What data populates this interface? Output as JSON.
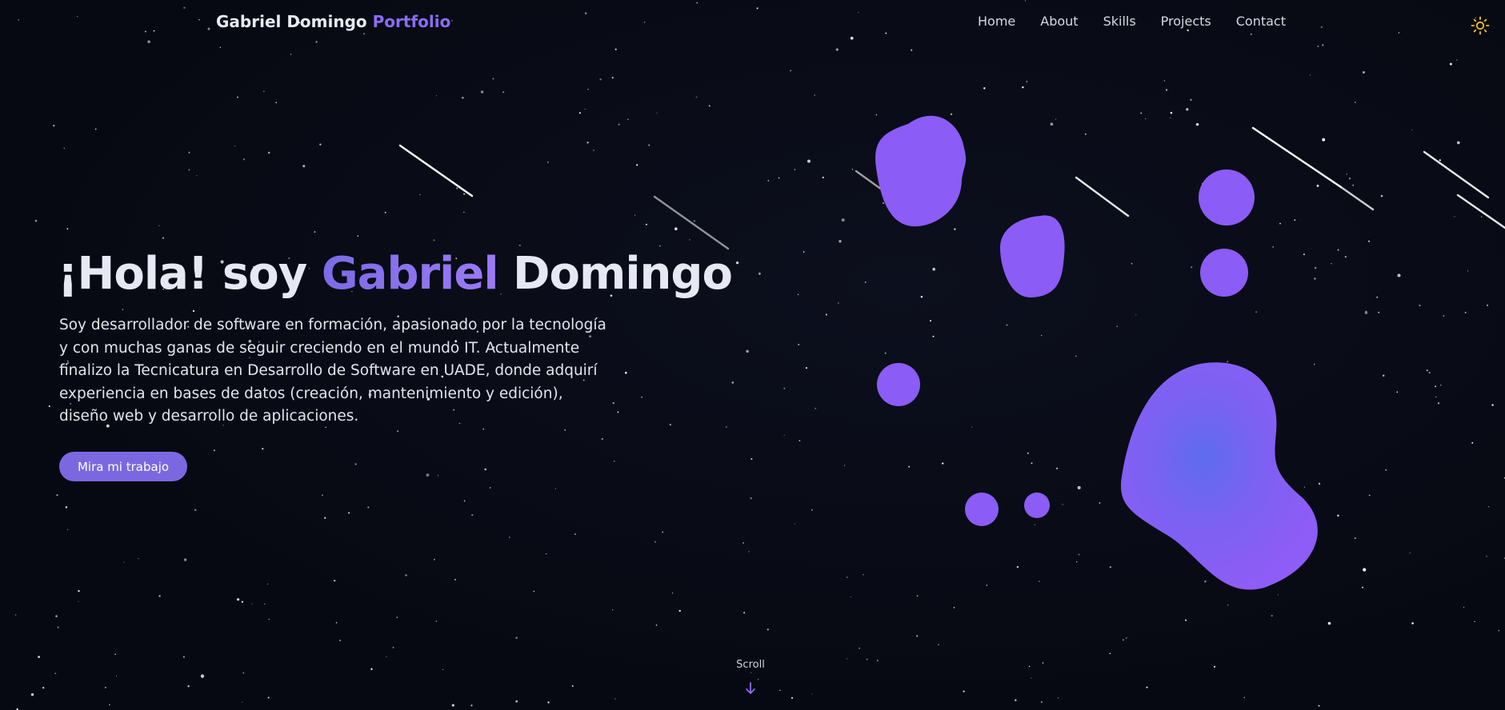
{
  "header": {
    "brand_name": "Gabriel Domingo",
    "brand_accent": "Portfolio",
    "nav": [
      "Home",
      "About",
      "Skills",
      "Projects",
      "Contact"
    ],
    "theme_icon": "sun-icon"
  },
  "hero": {
    "greeting": "¡Hola! soy",
    "first_name": "Gabriel",
    "last_name": "Domingo",
    "description": "Soy desarrollador de software en formación, apasionado por la tecnología y con muchas ganas de seguir creciendo en el mundo IT. Actualmente finalizo la Tecnicatura en Desarrollo de Software en UADE, donde adquirí experiencia en bases de datos (creación, mantenimiento y edición), diseño web y desarrollo de aplicaciones.",
    "cta_label": "Mira mi trabajo"
  },
  "scroll": {
    "label": "Scroll",
    "icon": "arrow-down-icon"
  },
  "colors": {
    "background": "#080a14",
    "accent": "#8b5cf6",
    "accent_blue": "#6366f1",
    "sun": "#f5c518"
  }
}
